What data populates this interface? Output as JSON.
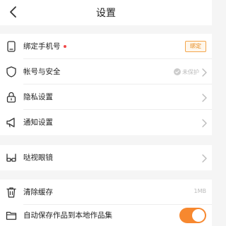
{
  "nav": {
    "title": "设置"
  },
  "items": [
    {
      "label": "绑定手机号",
      "action": "绑定"
    },
    {
      "label": "帐号与安全",
      "status": "未保护"
    },
    {
      "label": "隐私设置"
    },
    {
      "label": "通知设置"
    },
    {
      "label": "哒视眼镜"
    },
    {
      "label": "清除缓存",
      "value": "1MB"
    },
    {
      "label": "自动保存作品到本地作品集",
      "toggle_on": true
    }
  ],
  "colors": {
    "accent": "#f7882f",
    "badge_red": "#f04848",
    "background": "#f5f5f5"
  },
  "icons": [
    "back-arrow-icon",
    "phone-icon",
    "shield-icon",
    "lock-icon",
    "megaphone-icon",
    "glasses-icon",
    "trash-icon",
    "folder-icon",
    "chevron-right-icon",
    "check-circle-icon"
  ]
}
